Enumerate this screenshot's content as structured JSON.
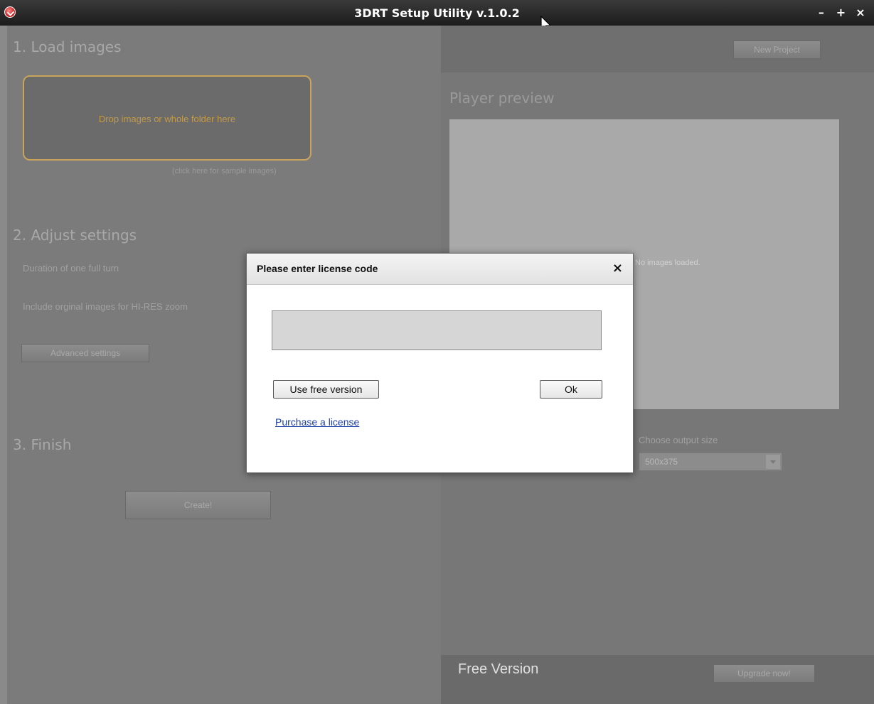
{
  "window": {
    "title": "3DRT Setup Utility v.1.0.2",
    "controls": {
      "minimize": "–",
      "maximize": "+",
      "close": "×"
    }
  },
  "left": {
    "section1": {
      "title": "1. Load images",
      "drop_text": "Drop images or whole folder here",
      "sample_link": "(click here for sample images)"
    },
    "section2": {
      "title": "2. Adjust settings",
      "duration_label": "Duration of one full turn",
      "include_label": "Include orginal images for HI-RES zoom",
      "advanced_button": "Advanced settings"
    },
    "section3": {
      "title": "3. Finish",
      "create_button": "Create!"
    }
  },
  "right": {
    "new_project_button": "New Project",
    "preview_title": "Player preview",
    "preview_note": "No images loaded.",
    "output_size_label": "Choose output size",
    "output_size_value": "500x375",
    "free_version": "Free Version",
    "upgrade_button": "Upgrade now!"
  },
  "dialog": {
    "title": "Please enter license code",
    "close": "×",
    "license_value": "",
    "use_free_button": "Use free version",
    "ok_button": "Ok",
    "purchase_link": "Purchase a license"
  }
}
